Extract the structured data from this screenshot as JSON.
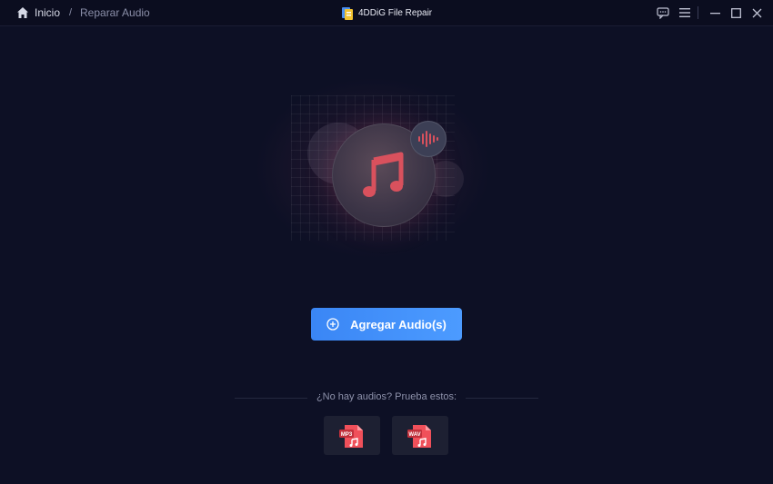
{
  "breadcrumb": {
    "home_label": "Inicio",
    "separator": "/",
    "current": "Reparar Audio"
  },
  "app": {
    "title": "4DDiG File Repair"
  },
  "window_controls": [
    "feedback-icon",
    "menu-icon",
    "minimize-icon",
    "maximize-icon",
    "close-icon"
  ],
  "hero": {
    "icon": "music-note-icon",
    "badge_icon": "sound-wave-icon"
  },
  "actions": {
    "add_audio_label": "Agregar Audio(s)"
  },
  "samples": {
    "prompt": "¿No hay audios? Prueba estos:",
    "items": [
      {
        "badge": "MP3",
        "icon": "mp3-file-icon"
      },
      {
        "badge": "WAV",
        "icon": "wav-file-icon"
      }
    ]
  },
  "colors": {
    "background": "#0d1025",
    "accent": "#3a86f5",
    "file_icon": "#f0505a"
  }
}
